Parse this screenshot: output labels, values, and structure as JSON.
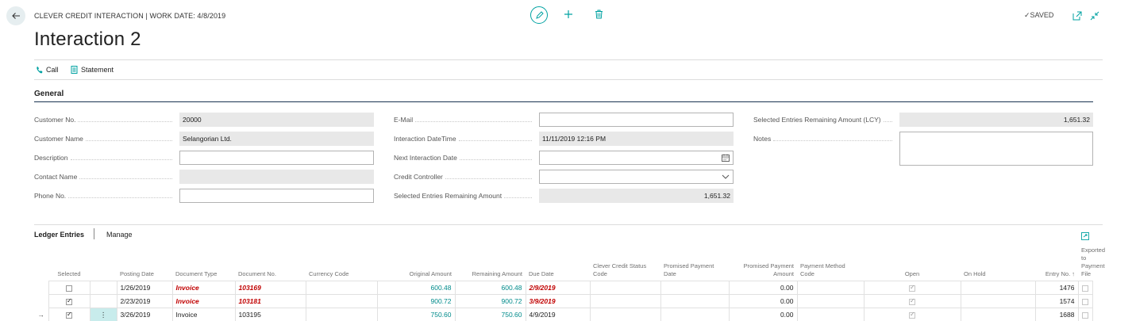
{
  "header": {
    "breadcrumb": "CLEVER CREDIT INTERACTION | WORK DATE: 4/8/2019",
    "title": "Interaction 2",
    "saved_label": "SAVED"
  },
  "actions": {
    "call_label": "Call",
    "statement_label": "Statement"
  },
  "general": {
    "section_title": "General",
    "customer_no": {
      "label": "Customer No.",
      "value": "20000"
    },
    "customer_name": {
      "label": "Customer Name",
      "value": "Selangorian Ltd."
    },
    "description": {
      "label": "Description",
      "value": ""
    },
    "contact_name": {
      "label": "Contact Name",
      "value": ""
    },
    "phone_no": {
      "label": "Phone No.",
      "value": ""
    },
    "email": {
      "label": "E-Mail",
      "value": ""
    },
    "interaction_datetime": {
      "label": "Interaction DateTime",
      "value": "11/11/2019 12:16 PM"
    },
    "next_interaction_date": {
      "label": "Next Interaction Date",
      "value": ""
    },
    "credit_controller": {
      "label": "Credit Controller",
      "value": ""
    },
    "selected_remaining": {
      "label": "Selected Entries Remaining Amount",
      "value": "1,651.32"
    },
    "selected_remaining_lcy": {
      "label": "Selected Entries Remaining Amount (LCY)",
      "value": "1,651.32"
    },
    "notes": {
      "label": "Notes",
      "value": ""
    }
  },
  "ledger": {
    "tab_label": "Ledger Entries",
    "manage_label": "Manage",
    "columns": {
      "selected": "Selected",
      "posting_date": "Posting Date",
      "document_type": "Document Type",
      "document_no": "Document No.",
      "currency_code": "Currency Code",
      "original_amount": "Original Amount",
      "remaining_amount": "Remaining Amount",
      "due_date": "Due Date",
      "clever_status": "Clever Credit Status Code",
      "promised_date": "Promised Payment Date",
      "promised_amount": "Promised Payment Amount",
      "payment_method": "Payment Method Code",
      "open": "Open",
      "on_hold": "On Hold",
      "entry_no": "Entry No. ↑",
      "exported": "Exported to Payment File"
    },
    "rows": [
      {
        "posting_date": "1/26/2019",
        "document_type": "Invoice",
        "document_no": "103169",
        "original_amount": "600.48",
        "remaining_amount": "600.48",
        "due_date": "2/9/2019",
        "promised_amount": "0.00",
        "entry_no": "1476"
      },
      {
        "posting_date": "2/23/2019",
        "document_type": "Invoice",
        "document_no": "103181",
        "original_amount": "900.72",
        "remaining_amount": "900.72",
        "due_date": "3/9/2019",
        "promised_amount": "0.00",
        "entry_no": "1574"
      },
      {
        "posting_date": "3/26/2019",
        "document_type": "Invoice",
        "document_no": "103195",
        "original_amount": "750.60",
        "remaining_amount": "750.60",
        "due_date": "4/9/2019",
        "promised_amount": "0.00",
        "entry_no": "1688"
      }
    ]
  },
  "colors": {
    "accent": "#00a2a2",
    "overdue": "#c00000",
    "amount_link": "#008b8b"
  }
}
